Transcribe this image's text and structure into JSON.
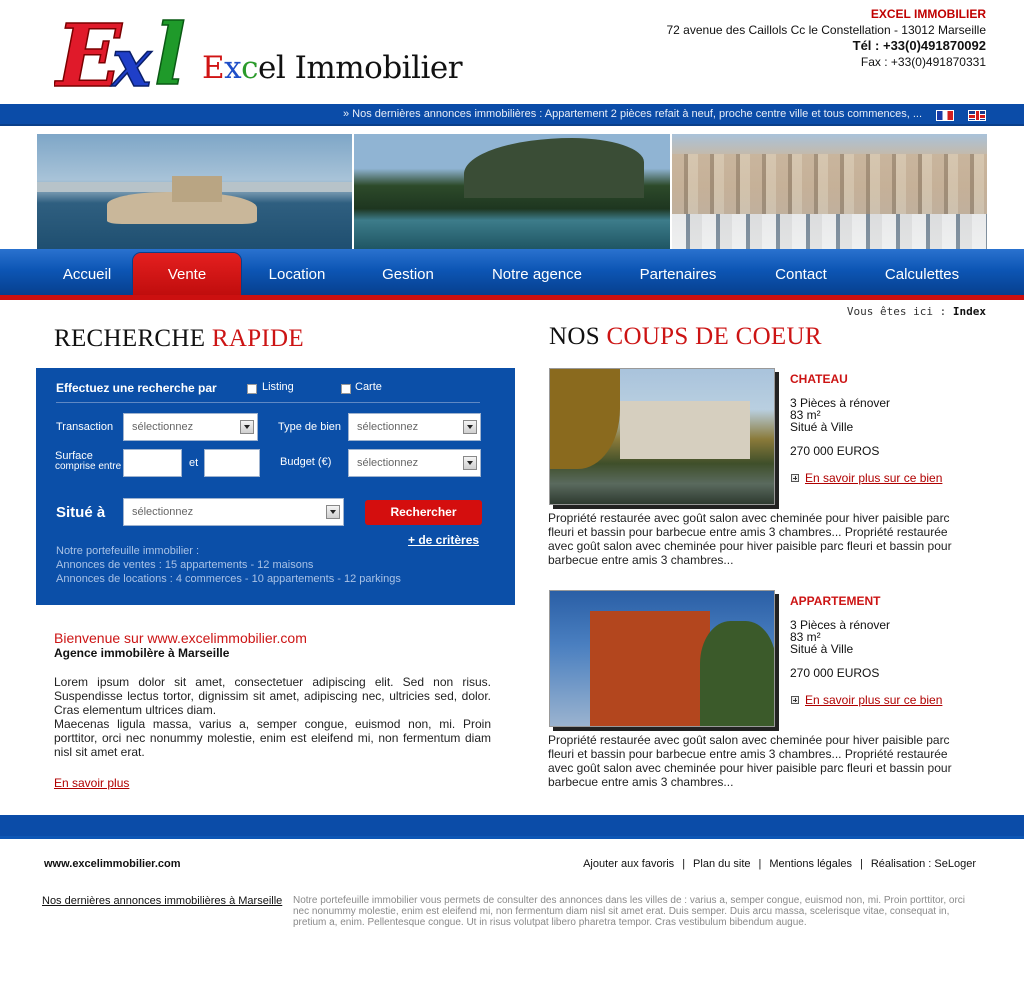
{
  "brand": {
    "logo_mark": "Exl",
    "logo_name": "Excel Immobilier"
  },
  "contact": {
    "company": "EXCEL IMMOBILIER",
    "address": "72 avenue des Caillols Cc le Constellation - 13012 Marseille",
    "tel": "Tél : +33(0)491870092",
    "fax": "Fax : +33(0)491870331"
  },
  "ticker": {
    "text": "» Nos dernières annonces immobilières : Appartement 2 pièces refait à neuf, proche centre ville et tous commences, ..."
  },
  "languages": [
    "fr-flag-icon",
    "en-flag-icon"
  ],
  "nav": {
    "items": [
      {
        "label": "Accueil"
      },
      {
        "label": "Vente"
      },
      {
        "label": "Location"
      },
      {
        "label": "Gestion"
      },
      {
        "label": "Notre agence"
      },
      {
        "label": "Partenaires"
      },
      {
        "label": "Contact"
      },
      {
        "label": "Calculettes"
      }
    ],
    "active": "Vente"
  },
  "breadcrumb": {
    "prefix": "Vous êtes ici :",
    "current": "Index"
  },
  "search": {
    "title_black": "RECHERCHE",
    "title_red": "RAPIDE",
    "heading": "Effectuez une recherche par",
    "options": [
      "Listing",
      "Carte"
    ],
    "transaction_label": "Transaction",
    "transaction_value": "sélectionnez",
    "type_label": "Type de bien",
    "type_value": "sélectionnez",
    "surface_label_1": "Surface",
    "surface_label_2": "comprise entre",
    "surface_and": "et",
    "budget_label": "Budget (€)",
    "budget_value": "sélectionnez",
    "situe_label": "Situé à",
    "situe_value": "sélectionnez",
    "button": "Rechercher",
    "more": "+ de critères",
    "portfolio": [
      "Notre portefeuille immobilier :",
      "Annonces de ventes : 15 appartements - 12 maisons",
      "Annonces de locations : 4 commerces - 10 appartements - 12 parkings"
    ]
  },
  "welcome": {
    "title": "Bienvenue sur www.excelimmobilier.com",
    "subtitle": "Agence immobilère à Marseille",
    "body": "Lorem ipsum dolor sit amet, consectetuer adipiscing elit. Sed non risus. Suspendisse lectus tortor, dignissim sit amet, adipiscing nec, ultricies sed, dolor. Cras elementum ultrices diam.",
    "body2": "Maecenas ligula massa, varius a, semper congue, euismod non, mi. Proin porttitor, orci nec nonummy molestie, enim est eleifend mi, non fermentum diam nisl sit amet erat.",
    "more": "En savoir plus"
  },
  "featured": {
    "title_black": "NOS",
    "title_red": "COUPS DE COEUR",
    "items": [
      {
        "type": "CHATEAU",
        "line1": "3 Pièces à rénover",
        "line2": "83 m²",
        "line3": "Situé à Ville",
        "price": "270 000 EUROS",
        "link": "En savoir plus sur ce bien",
        "description": "Propriété restaurée avec goût salon avec cheminée pour hiver paisible parc fleuri et bassin pour barbecue entre amis 3 chambres... Propriété restaurée avec goût salon avec cheminée pour hiver paisible parc fleuri et bassin pour barbecue entre amis 3 chambres..."
      },
      {
        "type": "APPARTEMENT",
        "line1": "3 Pièces à rénover",
        "line2": "83 m²",
        "line3": "Situé à Ville",
        "price": "270 000 EUROS",
        "link": "En savoir plus sur ce bien",
        "description": "Propriété restaurée avec goût salon avec cheminée pour hiver paisible parc fleuri et bassin pour barbecue entre amis 3 chambres... Propriété restaurée avec goût salon avec cheminée pour hiver paisible parc fleuri et bassin pour barbecue entre amis 3 chambres..."
      }
    ]
  },
  "footer": {
    "site": "www.excelimmobilier.com",
    "links": [
      "Ajouter aux favoris",
      "Plan du site",
      "Mentions légales",
      "Réalisation : SeLoger"
    ],
    "announce_link": "Nos dernières annonces immobilières à Marseille",
    "note": "Notre portefeuille immobilier vous permets de consulter des annonces dans les villes de : varius a, semper congue, euismod non, mi. Proin porttitor, orci nec nonummy molestie, enim est eleifend mi, non fermentum diam nisl sit amet erat. Duis semper. Duis arcu massa, scelerisque vitae, consequat in, pretium a, enim. Pellentesque congue. Ut in risus volutpat libero pharetra tempor. Cras vestibulum bibendum augue."
  },
  "colors": {
    "brand_blue": "#0b4ca8",
    "brand_red": "#cc1414"
  }
}
